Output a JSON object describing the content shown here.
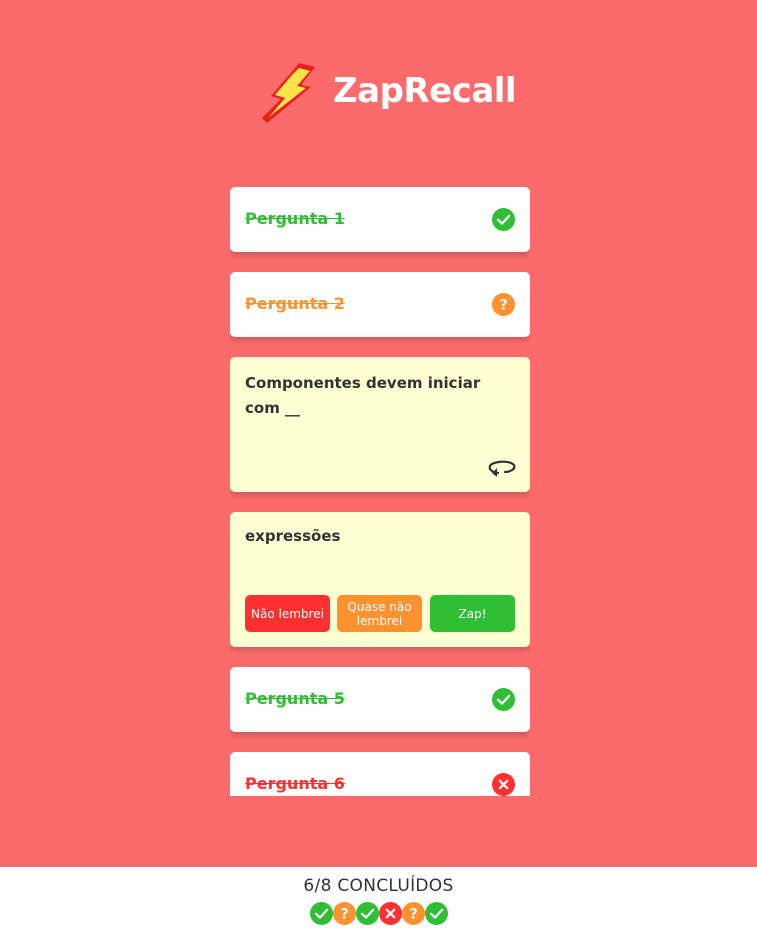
{
  "app": {
    "title": "ZapRecall"
  },
  "cards": [
    {
      "label": "Pergunta 1",
      "status": "correct",
      "status_icon": "check-circle-icon"
    },
    {
      "label": "Pergunta 2",
      "status": "almost",
      "status_icon": "question-circle-icon"
    },
    {
      "question": "Componentes devem iniciar com __",
      "flip_icon": "flip-arrow-icon"
    },
    {
      "answer": "expressões",
      "buttons": {
        "forgot": "Não lembrei",
        "almost": "Quase não lembrei",
        "zap": "Zap!"
      }
    },
    {
      "label": "Pergunta 5",
      "status": "correct",
      "status_icon": "check-circle-icon"
    },
    {
      "label": "Pergunta 6",
      "status": "wrong",
      "status_icon": "x-circle-icon"
    }
  ],
  "footer": {
    "progress": "6/8 CONCLUÍDOS",
    "answer_icons": [
      "check-circle-icon",
      "question-circle-icon",
      "check-circle-icon",
      "x-circle-icon",
      "question-circle-icon",
      "check-circle-icon"
    ]
  },
  "colors": {
    "background": "#FB6B6B",
    "correct": "#2FBE34",
    "almost": "#FF922E",
    "wrong": "#FF3030",
    "open_card": "#FFFFD4"
  }
}
